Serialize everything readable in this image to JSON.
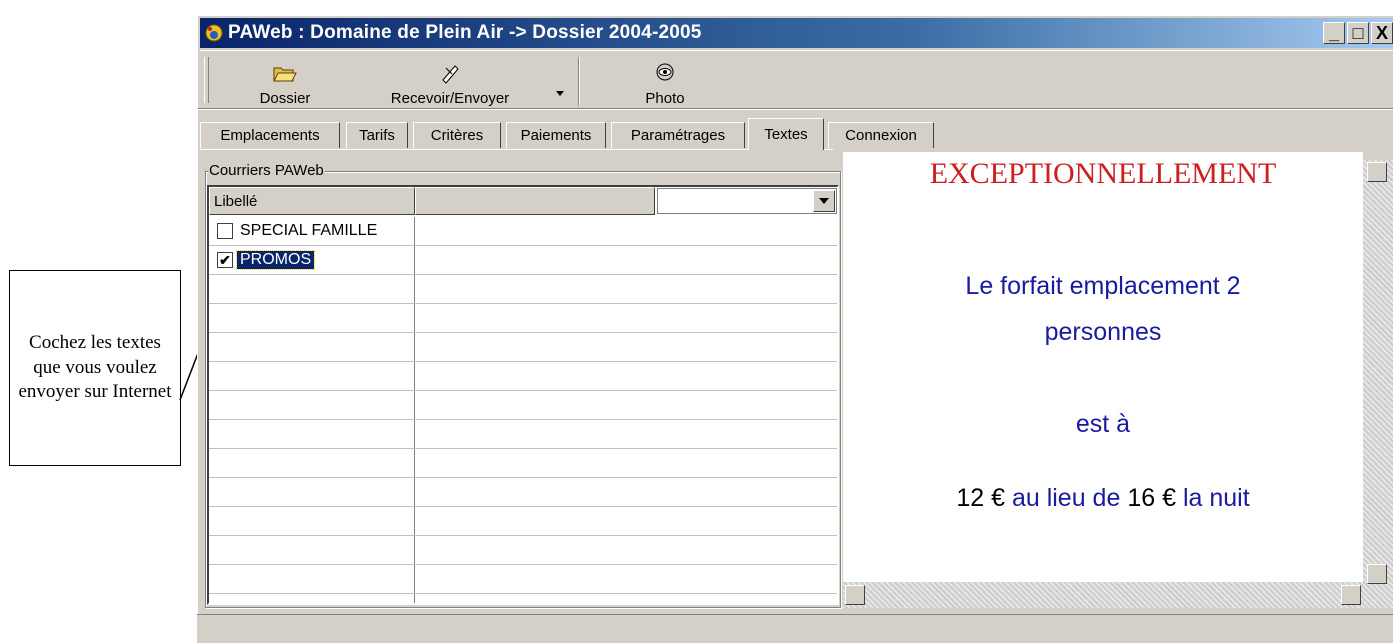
{
  "window": {
    "title": "PAWeb : Domaine de Plein Air -> Dossier 2004-2005",
    "controls": {
      "minimize": "_",
      "maximize": "□",
      "close": "X"
    }
  },
  "toolbar": {
    "buttons": [
      {
        "label": "Dossier",
        "icon": "open-folder-icon"
      },
      {
        "label": "Recevoir/Envoyer",
        "icon": "send-receive-icon"
      },
      {
        "label": "Photo",
        "icon": "eye-icon"
      }
    ]
  },
  "tabs": [
    {
      "label": "Emplacements"
    },
    {
      "label": "Tarifs"
    },
    {
      "label": "Critères"
    },
    {
      "label": "Paiements"
    },
    {
      "label": "Paramétrages"
    },
    {
      "label": "Textes",
      "active": true
    },
    {
      "label": "Connexion"
    }
  ],
  "group": {
    "label": "Courriers PAWeb"
  },
  "grid": {
    "column_header": "Libellé",
    "rows": [
      {
        "label": "SPECIAL FAMILLE",
        "checked": false,
        "check_mark": ""
      },
      {
        "label": "PROMOS",
        "checked": true,
        "check_mark": "✔"
      }
    ]
  },
  "preview": {
    "headline": "EXCEPTIONNELLEMENT",
    "line1": "Le forfait emplacement 2",
    "line2": "personnes",
    "line3": "est à",
    "price_new": "12 €",
    "mid_text": "au lieu de",
    "price_old": "16 €",
    "end_text": "la nuit",
    "colors": {
      "headline": "#cc2020",
      "body": "#1a1aa0",
      "price": "#000000"
    }
  },
  "callout": {
    "text": "Cochez les textes que vous voulez envoyer sur Internet"
  }
}
